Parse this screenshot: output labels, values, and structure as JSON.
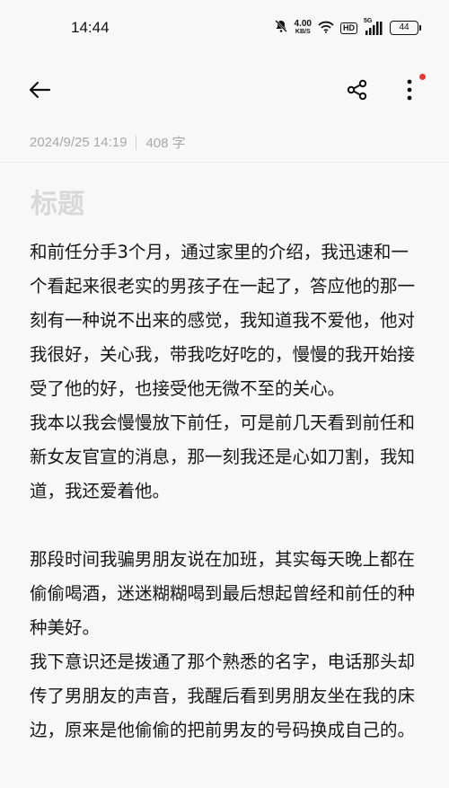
{
  "status_bar": {
    "time": "14:44",
    "net_speed_value": "4.00",
    "net_speed_unit": "KB/S",
    "hd_label": "HD",
    "signal_label": "5G",
    "battery": "44"
  },
  "toolbar": {
    "back_icon": "arrow-left",
    "share_icon": "share",
    "more_icon": "more-vertical",
    "notification_dot_color": "#e53935"
  },
  "meta": {
    "datetime": "2024/9/25 14:19",
    "word_count": "408 字"
  },
  "note": {
    "title_placeholder": "标题",
    "paragraphs": [
      "和前任分手3个月，通过家里的介绍，我迅速和一个看起来很老实的男孩子在一起了，答应他的那一刻有一种说不出来的感觉，我知道我不爱他，他对我很好，关心我，带我吃好吃的，慢慢的我开始接受了他的好，也接受他无微不至的关心。",
      "我本以我会慢慢放下前任，可是前几天看到前任和新女友官宣的消息，那一刻我还是心如刀割，我知道，我还爱着他。",
      "",
      "那段时间我骗男朋友说在加班，其实每天晚上都在偷偷喝酒，迷迷糊糊喝到最后想起曾经和前任的种种美好。",
      "我下意识还是拨通了那个熟悉的名字，电话那头却传了男朋友的声音，我醒后看到男朋友坐在我的床边，原来是他偷偷的把前男友的号码换成自己的。"
    ]
  }
}
